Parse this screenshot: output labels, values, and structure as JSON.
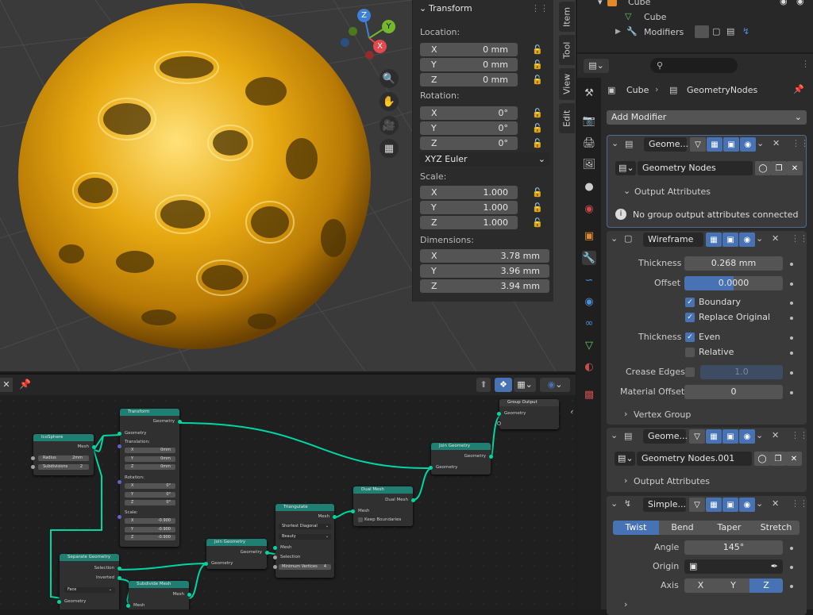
{
  "npanel": {
    "header": "Transform",
    "location_label": "Location:",
    "location": [
      {
        "k": "X",
        "v": "0 mm"
      },
      {
        "k": "Y",
        "v": "0 mm"
      },
      {
        "k": "Z",
        "v": "0 mm"
      }
    ],
    "rotation_label": "Rotation:",
    "rotation": [
      {
        "k": "X",
        "v": "0°"
      },
      {
        "k": "Y",
        "v": "0°"
      },
      {
        "k": "Z",
        "v": "0°"
      }
    ],
    "rotation_mode": "XYZ Euler",
    "scale_label": "Scale:",
    "scale": [
      {
        "k": "X",
        "v": "1.000"
      },
      {
        "k": "Y",
        "v": "1.000"
      },
      {
        "k": "Z",
        "v": "1.000"
      }
    ],
    "dimensions_label": "Dimensions:",
    "dimensions": [
      {
        "k": "X",
        "v": "3.78 mm"
      },
      {
        "k": "Y",
        "v": "3.96 mm"
      },
      {
        "k": "Z",
        "v": "3.94 mm"
      }
    ],
    "tabs": [
      "Item",
      "Tool",
      "View",
      "Edit"
    ]
  },
  "gizmo": {
    "z": "Z",
    "y": "Y",
    "x": "X"
  },
  "nodes": {
    "icosphere": {
      "title": "IcoSphere",
      "out": "Mesh",
      "radius_k": "Radius",
      "radius_v": "2mm",
      "subdiv_k": "Subdivisions",
      "subdiv_v": "2"
    },
    "transform": {
      "title": "Transform",
      "out": "Geometry",
      "in": "Geometry",
      "translation": "Translation:",
      "t": [
        {
          "k": "X",
          "v": "0mm"
        },
        {
          "k": "Y",
          "v": "0mm"
        },
        {
          "k": "Z",
          "v": "0mm"
        }
      ],
      "rotation": "Rotation:",
      "r": [
        {
          "k": "X",
          "v": "0°"
        },
        {
          "k": "Y",
          "v": "0°"
        },
        {
          "k": "Z",
          "v": "0°"
        }
      ],
      "scale": "Scale:",
      "s": [
        {
          "k": "X",
          "v": "-0.900"
        },
        {
          "k": "Y",
          "v": "-0.900"
        },
        {
          "k": "Z",
          "v": "-0.900"
        }
      ]
    },
    "separate": {
      "title": "Separate Geometry",
      "sel": "Selection",
      "inv": "Inverted",
      "mode": "Face",
      "geo": "Geometry"
    },
    "subdivide": {
      "title": "Subdivide Mesh",
      "out": "Mesh",
      "in": "Mesh"
    },
    "join1": {
      "title": "Join Geometry",
      "out": "Geometry",
      "in": "Geometry"
    },
    "triangulate": {
      "title": "Triangulate",
      "out": "Mesh",
      "quad": "Shortest Diagonal",
      "ngon": "Beauty",
      "mesh": "Mesh",
      "sel": "Selection",
      "minv": "Minimum Vertices",
      "minv_v": "4"
    },
    "dualmesh": {
      "title": "Dual Mesh",
      "out": "Dual Mesh",
      "in": "Mesh",
      "keep": "Keep Boundaries"
    },
    "join2": {
      "title": "Join Geometry",
      "out": "Geometry",
      "in": "Geometry"
    },
    "groupout": {
      "title": "Group Output",
      "in": "Geometry"
    }
  },
  "outliner": {
    "row1": "Cube",
    "row2": "Cube",
    "row3": "Modifiers"
  },
  "props": {
    "breadcrumb_obj": "Cube",
    "breadcrumb_mod": "GeometryNodes",
    "add_modifier": "Add Modifier",
    "gn1": {
      "name": "Geome...",
      "tree": "Geometry Nodes",
      "output_attrs": "Output Attributes",
      "info": "No group output attributes connected"
    },
    "wire": {
      "name": "Wireframe",
      "thickness_label": "Thickness",
      "thickness": "0.268 mm",
      "offset_label": "Offset",
      "offset": "0.0000",
      "offset_fraction": 0.5,
      "boundary": "Boundary",
      "replace": "Replace Original",
      "thick2_label": "Thickness",
      "even": "Even",
      "relative": "Relative",
      "crease_label": "Crease Edges",
      "crease": "1.0",
      "mat_label": "Material Offset",
      "mat": "0",
      "vgroup": "Vertex Group"
    },
    "gn2": {
      "name": "Geome...",
      "tree": "Geometry Nodes.001",
      "output_attrs": "Output Attributes"
    },
    "simple": {
      "name": "Simple...",
      "modes": [
        "Twist",
        "Bend",
        "Taper",
        "Stretch"
      ],
      "angle_label": "Angle",
      "angle": "145°",
      "origin_label": "Origin",
      "axis_label": "Axis",
      "axes": [
        "X",
        "Y",
        "Z"
      ]
    }
  }
}
